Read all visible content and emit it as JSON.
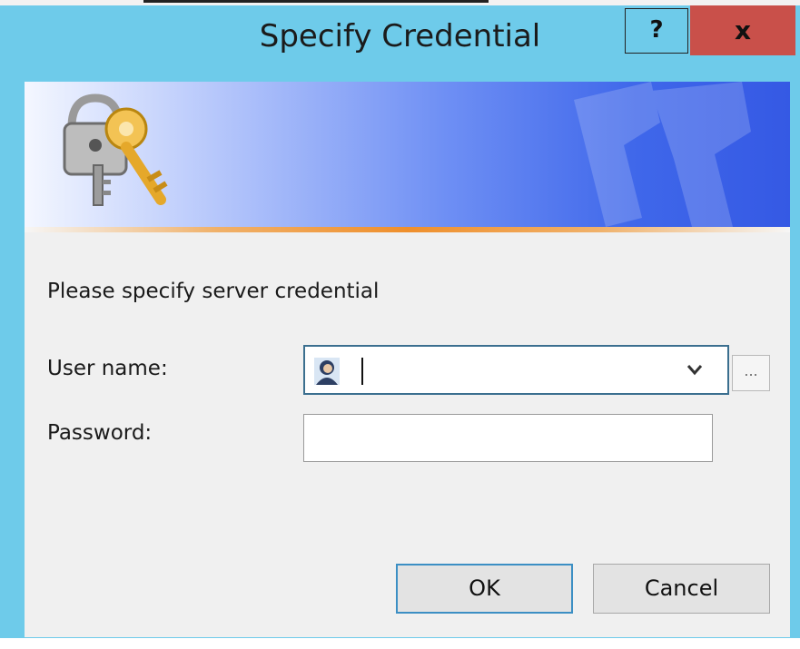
{
  "window": {
    "title": "Specify Credential",
    "help_label": "?",
    "close_label": "x"
  },
  "banner": {
    "icon": "keys-icon"
  },
  "form": {
    "prompt": "Please specify server credential",
    "user_name_label": "User name:",
    "user_name_value": "",
    "password_label": "Password:",
    "password_value": "",
    "browse_label": "...",
    "user_icon": "user-icon"
  },
  "buttons": {
    "ok_label": "OK",
    "cancel_label": "Cancel"
  },
  "colors": {
    "titlebar": "#6ecbea",
    "close": "#c9504a",
    "banner_light": "#f4f7ff",
    "banner_dark": "#3559e4",
    "accent_line": "#ef8f2c",
    "focus_border": "#3c8fc4"
  }
}
